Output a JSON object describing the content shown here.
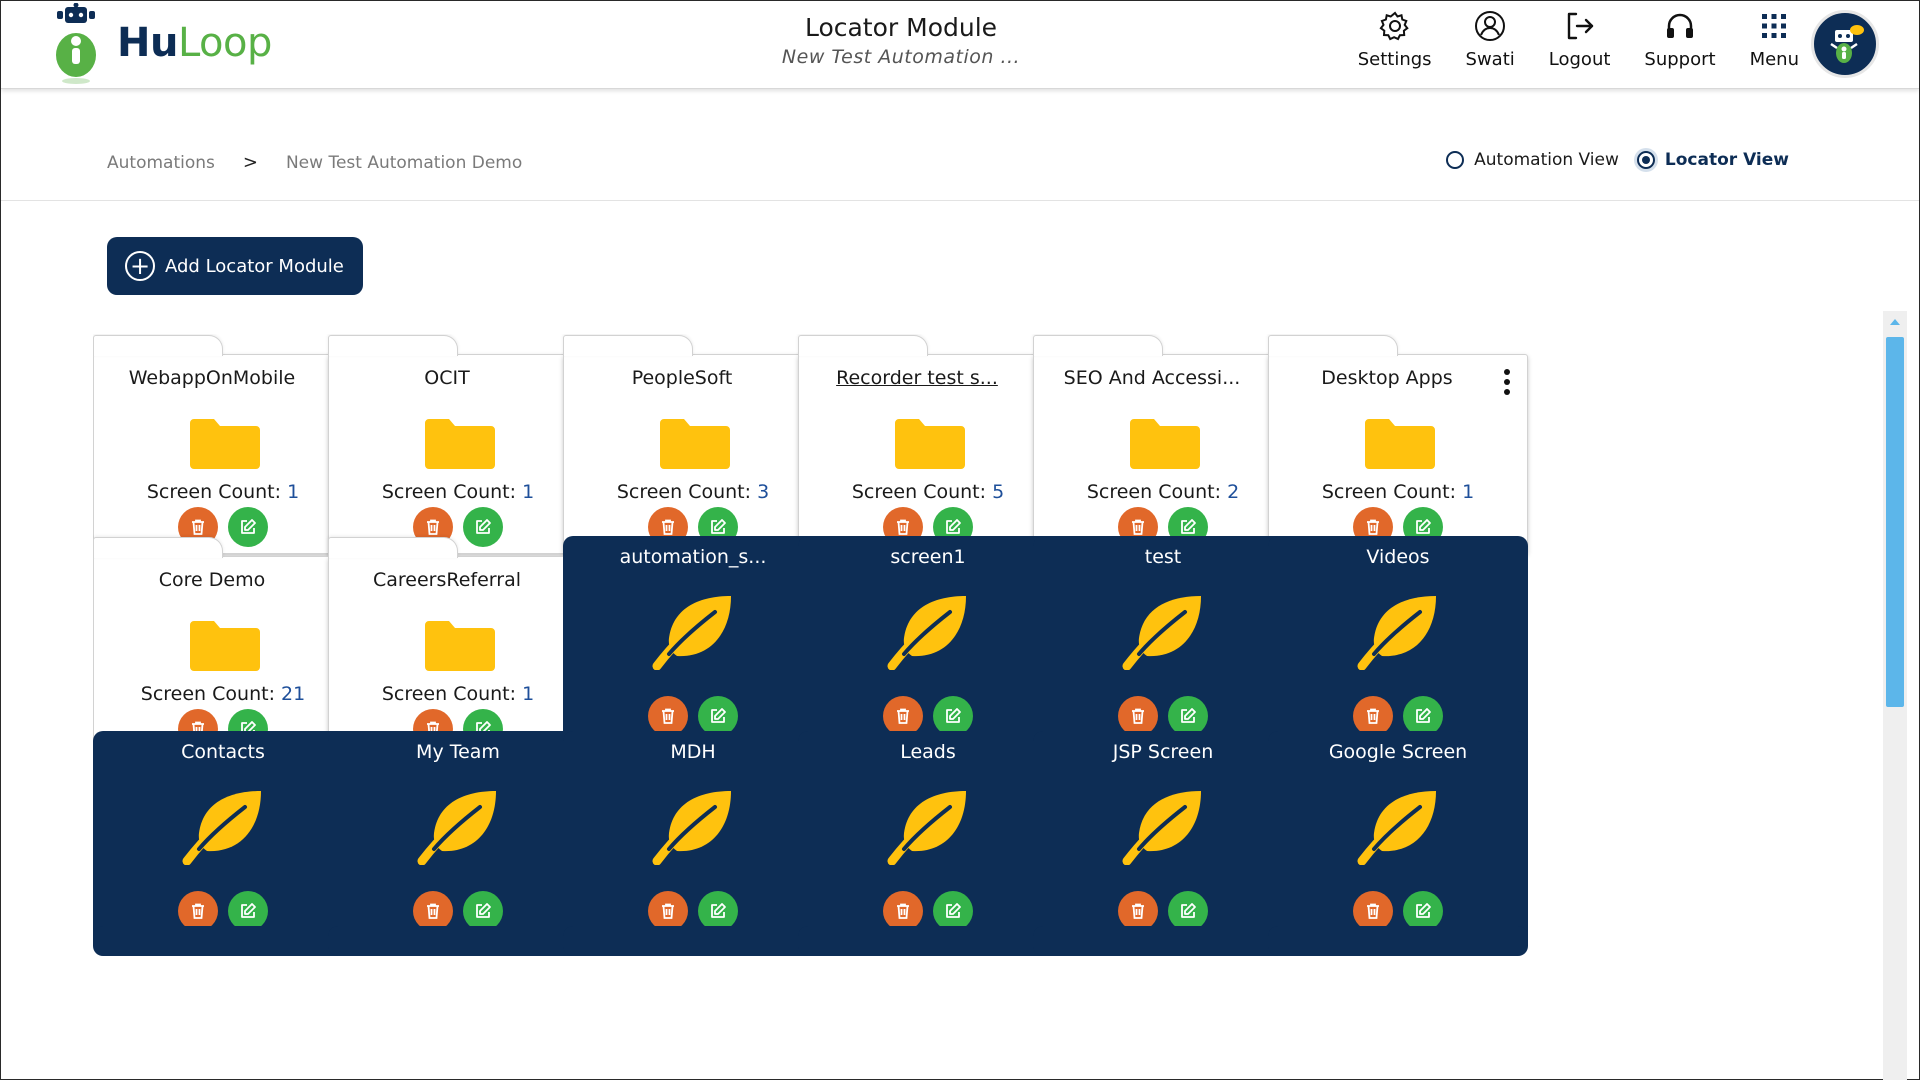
{
  "header": {
    "brand": {
      "hu": "Hu",
      "loop": "Loop"
    },
    "title": "Locator Module",
    "subtitle": "New Test Automation ...",
    "nav": [
      {
        "label": "Settings",
        "icon": "gear-icon"
      },
      {
        "label": "Swati",
        "icon": "user-icon"
      },
      {
        "label": "Logout",
        "icon": "logout-icon"
      },
      {
        "label": "Support",
        "icon": "headset-icon"
      },
      {
        "label": "Menu",
        "icon": "grid-icon"
      }
    ]
  },
  "breadcrumb": {
    "items": [
      "Automations",
      "New Test Automation Demo"
    ],
    "separator": ">"
  },
  "views": {
    "automation": "Automation View",
    "locator": "Locator View",
    "selected": "locator"
  },
  "add_button": {
    "label": "Add Locator Module"
  },
  "colors": {
    "navy": "#0d2d55",
    "folder": "#ffc20e",
    "delete": "#e1682a",
    "edit": "#34b34a",
    "count": "#1e4f9a"
  },
  "folders": [
    {
      "title": "WebappOnMobile",
      "count_label": "Screen Count: ",
      "count": "1"
    },
    {
      "title": "OCIT",
      "count_label": "Screen Count: ",
      "count": "1"
    },
    {
      "title": "PeopleSoft",
      "count_label": "Screen Count: ",
      "count": "3"
    },
    {
      "title": "Recorder test s...",
      "count_label": "Screen Count: ",
      "count": "5"
    },
    {
      "title": "SEO And Accessi...",
      "count_label": "Screen Count: ",
      "count": "2"
    },
    {
      "title": "Desktop Apps",
      "count_label": "Screen Count: ",
      "count": "1"
    },
    {
      "title": "Core Demo",
      "count_label": "Screen Count: ",
      "count": "21"
    },
    {
      "title": "CareersReferral",
      "count_label": "Screen Count: ",
      "count": "1"
    }
  ],
  "screens": [
    {
      "title": "automation_s..."
    },
    {
      "title": "screen1"
    },
    {
      "title": "test"
    },
    {
      "title": "Videos"
    },
    {
      "title": "Contacts"
    },
    {
      "title": "My Team"
    },
    {
      "title": "MDH"
    },
    {
      "title": "Leads"
    },
    {
      "title": "JSP Screen"
    },
    {
      "title": "Google Screen"
    }
  ]
}
